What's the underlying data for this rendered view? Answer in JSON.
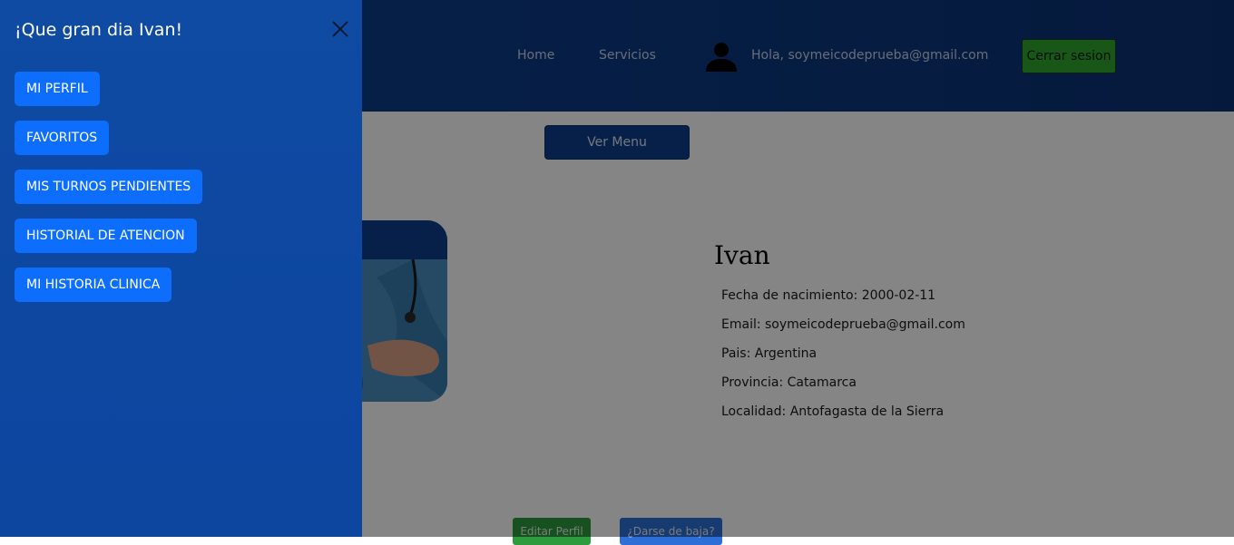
{
  "navbar": {
    "links": [
      "Home",
      "Servicios"
    ],
    "greeting": "Hola, soymeicodeprueba@gmail.com",
    "logout_label": "Cerrar sesion"
  },
  "main": {
    "menu_button_label": "Ver Menu",
    "profile": {
      "name": "Ivan",
      "birth_date": "Fecha de nacimiento: 2000-02-11",
      "email": "Email: soymeicodeprueba@gmail.com",
      "country": "Pais: Argentina",
      "province": "Provincia: Catamarca",
      "locality": "Localidad: Antofagasta de la Sierra"
    },
    "edit_label": "Editar Perfil",
    "unsubscribe_label": "¿Darse de baja?"
  },
  "drawer": {
    "title": "¡Que gran dia Ivan!",
    "items": [
      {
        "label": "MI PERFIL"
      },
      {
        "label": "FAVORITOS"
      },
      {
        "label": "MIS TURNOS PENDIENTES"
      },
      {
        "label": "HISTORIAL DE ATENCION"
      },
      {
        "label": "MI HISTORIA CLINICA"
      }
    ]
  },
  "colors": {
    "navbar": "#0e3f8c",
    "drawer": "#0d47a0",
    "drawer_button": "#0d6efd",
    "logout_button": "#2ea82e",
    "edit_button": "#2e9b3e"
  },
  "icons": [
    "user-icon",
    "close-icon"
  ]
}
